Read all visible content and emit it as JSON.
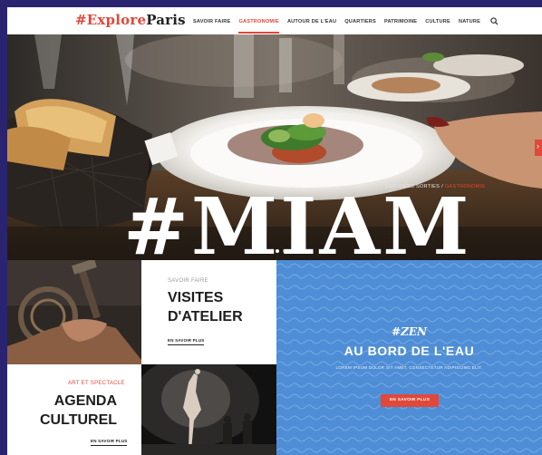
{
  "header": {
    "logo_hash": "#Explore",
    "logo_city": "Paris",
    "nav": [
      {
        "label": "SAVOIR FAIRE"
      },
      {
        "label": "GASTRONOMIE"
      },
      {
        "label": "AUTOUR DE L'EAU"
      },
      {
        "label": "QUARTIERS"
      },
      {
        "label": "PATRIMOINE"
      },
      {
        "label": "CULTURE"
      },
      {
        "label": "NATURE"
      }
    ],
    "active_nav": "GASTRONOMIE",
    "search_icon": "search-icon"
  },
  "hero": {
    "breadcrumb_parent": "LES IDÉES SORTIES",
    "breadcrumb_sep": "/",
    "breadcrumb_current": "GASTRONOMIE",
    "title": "#MIAM",
    "next_icon": "chevron-right-icon",
    "next_glyph": "›"
  },
  "cards": {
    "atelier": {
      "kicker": "SAVOIR FAIRE",
      "title_line1": "VISITES",
      "title_line2": "D'ATELIER",
      "link": "EN SAVOIR PLUS"
    },
    "agenda": {
      "kicker": "ART ET SPECTACLE",
      "title_line1": "AGENDA",
      "title_line2": "CULTUREL",
      "link": "EN SAVOIR PLUS"
    },
    "zen": {
      "tag": "#ZEN",
      "title": "AU BORD DE L'EAU",
      "lorem": "LOREM IPSUM DOLOR SIT AMET, CONSECTETUR ADIPISCING ELIT.",
      "button": "EN SAVOIR PLUS"
    }
  },
  "colors": {
    "accent": "#e0483a",
    "background": "#2a2470",
    "zen_blue": "#4f8ed6"
  }
}
